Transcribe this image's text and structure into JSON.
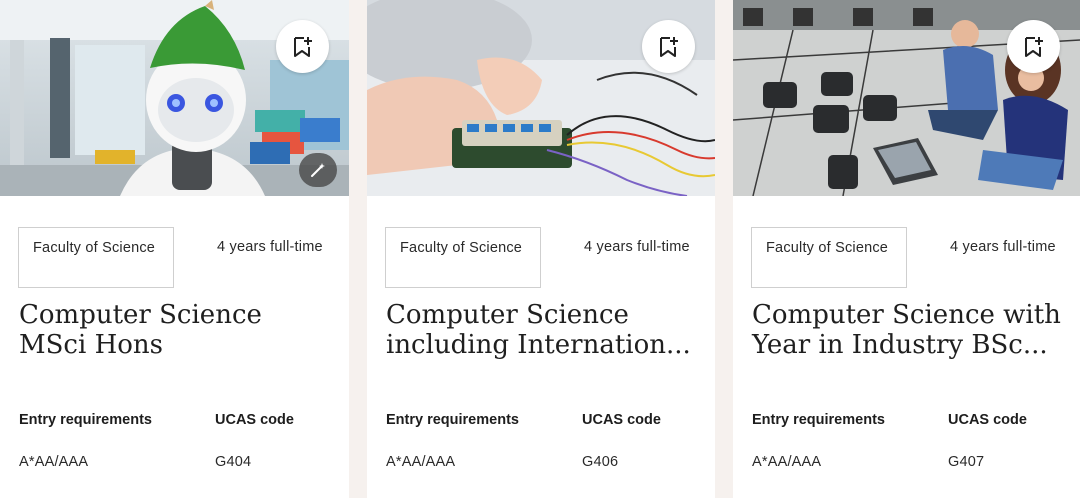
{
  "cards": [
    {
      "photo": "robot-with-green-hat-photo",
      "faculty": "Faculty of Science",
      "duration": "4 years full-time",
      "title": "Computer Science MSci Hons",
      "entry_label": "Entry requirements",
      "entry_value": "A*AA/AAA",
      "ucas_label": "UCAS code",
      "ucas_value": "G404",
      "bookmark_icon": "bookmark-add-icon",
      "wand_icon": "magic-wand-icon"
    },
    {
      "photo": "circuit-board-hands-photo",
      "faculty": "Faculty of Science",
      "duration": "4 years full-time",
      "title": "Computer Science including Internation...",
      "entry_label": "Entry requirements",
      "entry_value": "A*AA/AAA",
      "ucas_label": "UCAS code",
      "ucas_value": "G406",
      "bookmark_icon": "bookmark-add-icon"
    },
    {
      "photo": "robots-lab-students-photo",
      "faculty": "Faculty of Science",
      "duration": "4 years full-time",
      "title": "Computer Science with Year in Industry BSc...",
      "entry_label": "Entry requirements",
      "entry_value": "A*AA/AAA",
      "ucas_label": "UCAS code",
      "ucas_value": "G407",
      "bookmark_icon": "bookmark-add-icon"
    }
  ],
  "colors": {
    "page_background": "#f6f1ee",
    "card_background": "#ffffff",
    "border": "#cfcfcf",
    "text": "#1d1d1d"
  }
}
